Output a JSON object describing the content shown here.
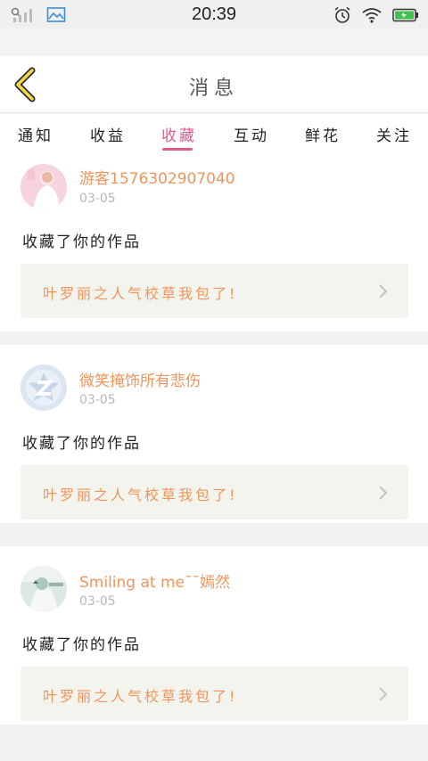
{
  "status_bar": {
    "time": "20:39",
    "battery_color": "#3fbf4c",
    "icons": [
      "signal-icon",
      "gallery-notification-icon",
      "alarm-icon",
      "wifi-icon",
      "battery-icon"
    ]
  },
  "header": {
    "title": "消息",
    "back_icon": "chevron-left-icon"
  },
  "tabs": [
    {
      "label": "通知",
      "active": false
    },
    {
      "label": "收益",
      "active": false
    },
    {
      "label": "收藏",
      "active": true
    },
    {
      "label": "互动",
      "active": false
    },
    {
      "label": "鲜花",
      "active": false
    },
    {
      "label": "关注",
      "active": false
    }
  ],
  "colors": {
    "accent": "#e05a8c",
    "name": "#f0955a",
    "date": "#b8b8b8",
    "work_bg": "#f4f4ee",
    "background": "#f2f2f2"
  },
  "messages": [
    {
      "username": "游客1576302907040",
      "date": "03-05",
      "action": "收藏了你的作品",
      "work_title": "叶罗丽之人气校草我包了!"
    },
    {
      "username": "微笑掩饰所有悲伤",
      "date": "03-05",
      "action": "收藏了你的作品",
      "work_title": "叶罗丽之人气校草我包了!"
    },
    {
      "username": "Smiling at me¯¯嫣然",
      "date": "03-05",
      "action": "收藏了你的作品",
      "work_title": "叶罗丽之人气校草我包了!"
    }
  ]
}
